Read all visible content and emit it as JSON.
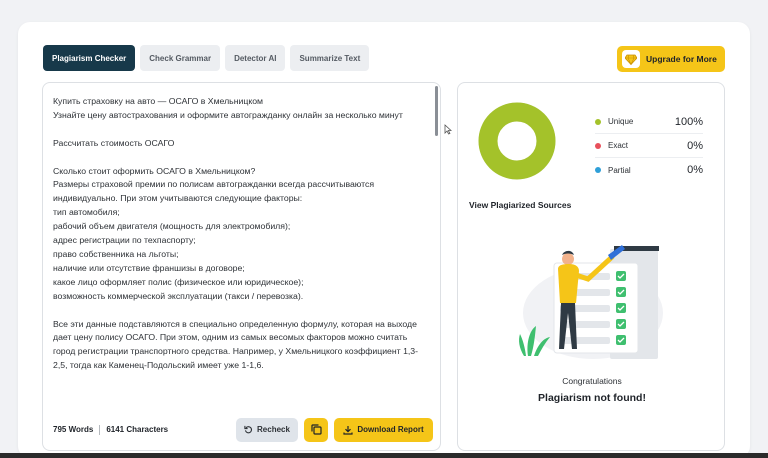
{
  "tabs": [
    {
      "label": "Plagiarism Checker",
      "active": true
    },
    {
      "label": "Check Grammar",
      "active": false
    },
    {
      "label": "Detector AI",
      "active": false
    },
    {
      "label": "Summarize Text",
      "active": false
    }
  ],
  "upgrade": {
    "label": "Upgrade for More",
    "icon": "diamond-icon"
  },
  "editor": {
    "paragraphs": [
      "Купить страховку на авто — ОСАГО в Хмельницком\nУзнайте цену автострахования и оформите автогражданку онлайн за несколько минут",
      "Рассчитать стоимость ОСАГО",
      "Сколько стоит оформить ОСАГО в Хмельницком?\nРазмеры страховой премии по полисам автогражданки всегда рассчитываются индивидуально. При этом учитываются следующие факторы:\nтип автомобиля;\nрабочий объем двигателя (мощность для электромобиля);\nадрес регистрации по техпаспорту;\nправо собственника на льготы;\nналичие или отсутствие франшизы в договоре;\nкакое лицо оформляет полис (физическое или юридическое);\nвозможность коммерческой эксплуатации (такси / перевозка).",
      "Все эти данные подставляются в специально определенную формулу, которая на выходе дает цену полису ОСАГО. При этом, одним из самых весомых факторов можно считать город регистрации транспортного средства. Например, у Хмельницкого коэффициент 1,3-2,5, тогда как Каменец-Подольский имеет уже 1-1,6."
    ],
    "word_count": "795 Words",
    "char_count": "6141 Characters",
    "recheck_label": "Recheck",
    "download_label": "Download Report"
  },
  "results": {
    "legend": [
      {
        "label": "Unique",
        "value": "100%",
        "color": "#a4c22a"
      },
      {
        "label": "Exact",
        "value": "0%",
        "color": "#e8505b"
      },
      {
        "label": "Partial",
        "value": "0%",
        "color": "#2f9fd8"
      }
    ],
    "donut_unique_fraction": 1.0,
    "view_sources_label": "View Plagiarized Sources",
    "congrats": "Congratulations",
    "not_found": "Plagiarism not found!"
  },
  "colors": {
    "accent": "#f5c518",
    "primary": "#17394a",
    "unique": "#a4c22a"
  }
}
